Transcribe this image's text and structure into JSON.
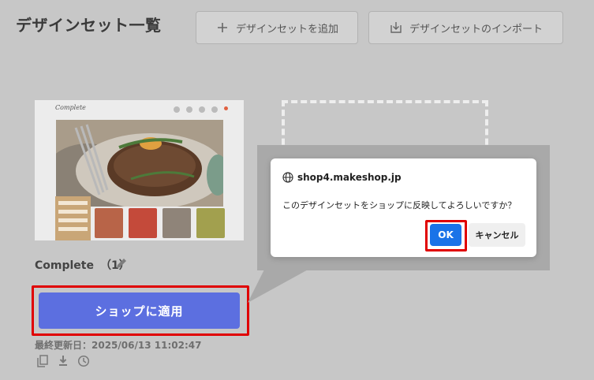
{
  "header": {
    "title": "デザインセット一覧",
    "add_label": "デザインセットを追加",
    "import_label": "デザインセットのインポート"
  },
  "card": {
    "preview_logo": "Complete",
    "name": "Complete",
    "count": "（1）",
    "apply_label": "ショップに適用",
    "updated_label": "最終更新日：2025/06/13 11:02:47"
  },
  "dialog": {
    "domain": "shop4.makeshop.jp",
    "message": "このデザインセットをショップに反映してよろしいですか？",
    "ok_label": "OK",
    "cancel_label": "キャンセル"
  },
  "icons": {
    "add": "plus-icon",
    "import": "import-icon",
    "edit": "pencil-icon",
    "copy": "copy-icon",
    "download": "download-icon",
    "history": "clock-icon",
    "site": "globe-icon"
  },
  "colors": {
    "overlay_bg": "#c7c7c7",
    "apply_button": "#5c6fe0",
    "ok_button": "#1a73e8",
    "highlight_frame": "#e00000"
  }
}
